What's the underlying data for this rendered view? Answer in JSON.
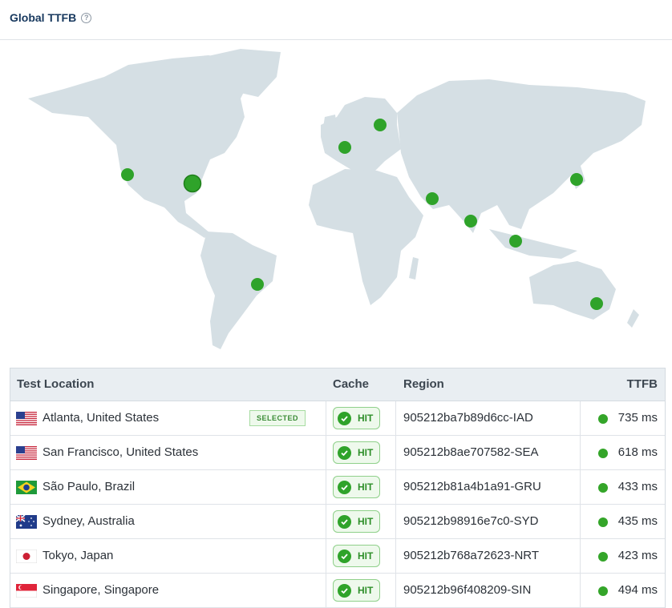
{
  "header": {
    "title": "Global TTFB",
    "help_icon": "question-circle-icon"
  },
  "colors": {
    "land": "#d5dfe4",
    "marker": "#2fa32a",
    "accent": "#17385e"
  },
  "table": {
    "columns": {
      "location": "Test Location",
      "cache": "Cache",
      "region": "Region",
      "ttfb": "TTFB"
    },
    "selected_label": "SELECTED",
    "rows": [
      {
        "flag": "us-flag",
        "location": "Atlanta, United States",
        "cache": "HIT",
        "region": "905212ba7b89d6cc-IAD",
        "ttfb": "735 ms"
      },
      {
        "flag": "us-flag",
        "location": "San Francisco, United States",
        "cache": "HIT",
        "region": "905212b8ae707582-SEA",
        "ttfb": "618 ms"
      },
      {
        "flag": "br-flag",
        "location": "São Paulo, Brazil",
        "cache": "HIT",
        "region": "905212b81a4b1a91-GRU",
        "ttfb": "433 ms"
      },
      {
        "flag": "au-flag",
        "location": "Sydney, Australia",
        "cache": "HIT",
        "region": "905212b98916e7c0-SYD",
        "ttfb": "435 ms"
      },
      {
        "flag": "jp-flag",
        "location": "Tokyo, Japan",
        "cache": "HIT",
        "region": "905212b768a72623-NRT",
        "ttfb": "423 ms"
      },
      {
        "flag": "sg-flag",
        "location": "Singapore, Singapore",
        "cache": "HIT",
        "region": "905212b96f408209-SIN",
        "ttfb": "494 ms"
      }
    ]
  }
}
